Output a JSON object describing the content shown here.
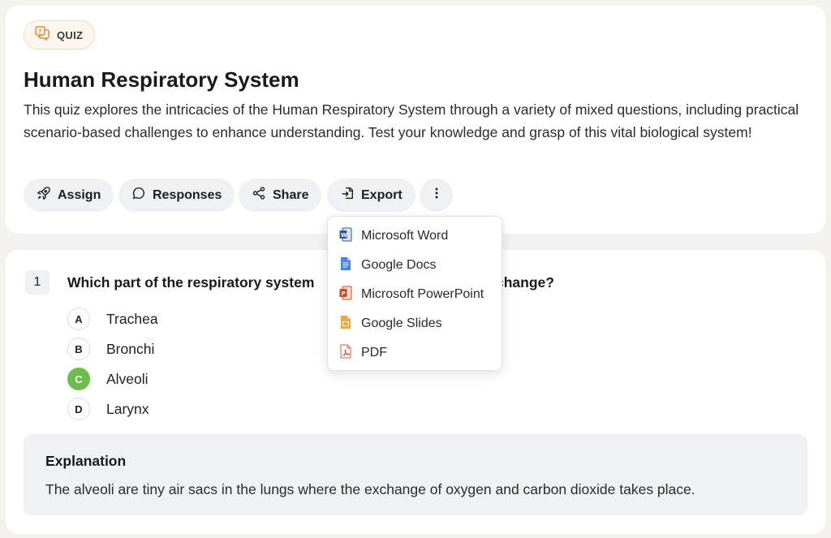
{
  "badge": {
    "label": "QUIZ",
    "icon": "quiz-icon",
    "color": "#e8893a"
  },
  "quiz": {
    "title": "Human Respiratory System",
    "description": "This quiz explores the intricacies of the Human Respiratory System through a variety of mixed questions, including practical scenario-based challenges to enhance understanding. Test your knowledge and grasp of this vital biological system!"
  },
  "toolbar": {
    "assign": {
      "label": "Assign",
      "icon": "rocket-icon"
    },
    "responses": {
      "label": "Responses",
      "icon": "chat-bubble-icon"
    },
    "share": {
      "label": "Share",
      "icon": "share-icon"
    },
    "export": {
      "label": "Export",
      "icon": "export-icon"
    },
    "more": {
      "icon": "vertical-ellipsis-icon"
    }
  },
  "export_menu": {
    "items": [
      {
        "label": "Microsoft Word",
        "icon": "microsoft-word-icon",
        "color": "#2b579a"
      },
      {
        "label": "Google Docs",
        "icon": "google-docs-icon",
        "color": "#4285f4"
      },
      {
        "label": "Microsoft PowerPoint",
        "icon": "microsoft-powerpoint-icon",
        "color": "#d24726"
      },
      {
        "label": "Google Slides",
        "icon": "google-slides-icon",
        "color": "#f4b400"
      },
      {
        "label": "PDF",
        "icon": "pdf-icon",
        "color": "#e2574c"
      }
    ]
  },
  "question": {
    "number": "1",
    "text_before": "Which part of the respiratory system",
    "text_after": "change?",
    "options": [
      {
        "letter": "A",
        "text": "Trachea",
        "correct": false
      },
      {
        "letter": "B",
        "text": "Bronchi",
        "correct": false
      },
      {
        "letter": "C",
        "text": "Alveoli",
        "correct": true
      },
      {
        "letter": "D",
        "text": "Larynx",
        "correct": false
      }
    ],
    "correct_color": "#6abf4b"
  },
  "explanation": {
    "title": "Explanation",
    "text": "The alveoli are tiny air sacs in the lungs where the exchange of oxygen and carbon dioxide takes place."
  }
}
